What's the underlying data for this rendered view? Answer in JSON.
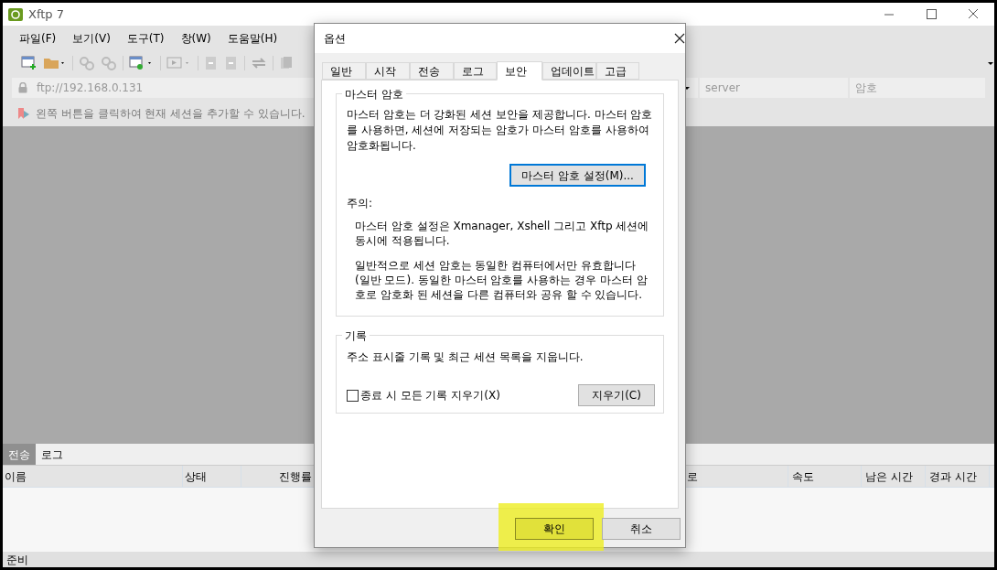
{
  "window": {
    "title": "Xftp 7"
  },
  "menu": [
    "파일(F)",
    "보기(V)",
    "도구(T)",
    "창(W)",
    "도움말(H)"
  ],
  "address_bar": {
    "value": "ftp://192.168.0.131",
    "username_placeholder": "server",
    "password_placeholder": "암호"
  },
  "hint": "왼쪽 버튼을 클릭하여 현재 세션을 추가할 수 있습니다.",
  "bottom_tabs": [
    {
      "label": "전송",
      "selected": true
    },
    {
      "label": "로그",
      "selected": false
    }
  ],
  "transfer_table": {
    "columns_left": [
      "이름",
      "상태",
      "진행률"
    ],
    "columns_right": [
      "로",
      "속도",
      "남은 시간",
      "경과 시간"
    ]
  },
  "status_bar": "준비",
  "dialog": {
    "title": "옵션",
    "tabs": [
      {
        "label": "일반",
        "selected": false
      },
      {
        "label": "시작",
        "selected": false
      },
      {
        "label": "전송",
        "selected": false
      },
      {
        "label": "로그",
        "selected": false
      },
      {
        "label": "보안",
        "selected": true
      },
      {
        "label": "업데이트",
        "selected": false
      },
      {
        "label": "고급",
        "selected": false
      }
    ],
    "master_password": {
      "title": "마스터 암호",
      "description": "마스터 암호는 더 강화된 세션 보안을 제공합니다. 마스터 암호를 사용하면, 세션에 저장되는 암호가 마스터 암호를 사용하여 암호화됩니다.",
      "button": "마스터 암호 설정(M)...",
      "note_label": "주의:",
      "notes": [
        "마스터 암호 설정은 Xmanager, Xshell 그리고 Xftp 세션에 동시에 적용됩니다.",
        "일반적으로 세션 암호는 동일한 컴퓨터에서만 유효합니다 (일반 모드). 동일한 마스터 암호를 사용하는 경우 마스터 암호로 암호화 된 세션을 다른 컴퓨터와 공유 할 수 있습니다."
      ]
    },
    "history": {
      "title": "기록",
      "description": "주소 표시줄 기록 및 최근 세션 목록을 지웁니다.",
      "checkbox": {
        "label": "종료 시 모든 기록 지우기(X)",
        "checked": false
      },
      "button": "지우기(C)"
    },
    "buttons": [
      {
        "label": "확인",
        "highlighted": true
      },
      {
        "label": "취소",
        "highlighted": false
      }
    ]
  }
}
